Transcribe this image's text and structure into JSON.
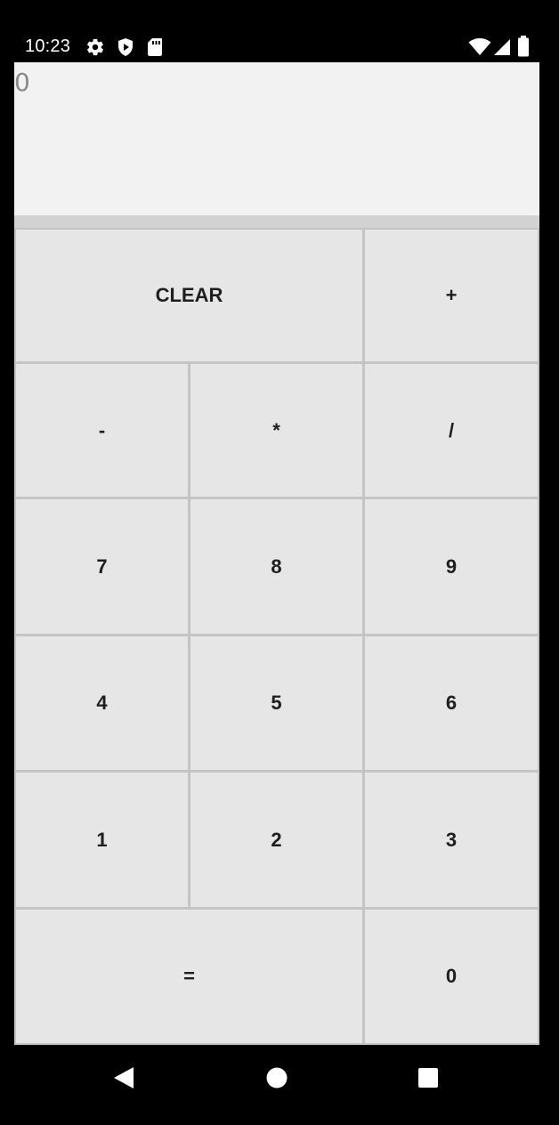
{
  "status_bar": {
    "time": "10:23",
    "left_icons": [
      "gear-icon",
      "shield-icon",
      "sd-card-icon"
    ],
    "right_icons": [
      "wifi-icon",
      "signal-icon",
      "battery-icon"
    ]
  },
  "display": {
    "value": "0"
  },
  "keys": {
    "clear": "CLEAR",
    "plus": "+",
    "minus": "-",
    "multiply": "*",
    "divide": "/",
    "seven": "7",
    "eight": "8",
    "nine": "9",
    "four": "4",
    "five": "5",
    "six": "6",
    "one": "1",
    "two": "2",
    "three": "3",
    "equals": "=",
    "zero": "0"
  },
  "nav_bar": {
    "buttons": [
      "back-icon",
      "home-icon",
      "recents-icon"
    ]
  },
  "colors": {
    "key_background": "#e6e6e6",
    "display_background": "#f2f2f2",
    "key_text": "#1e1e1e"
  }
}
